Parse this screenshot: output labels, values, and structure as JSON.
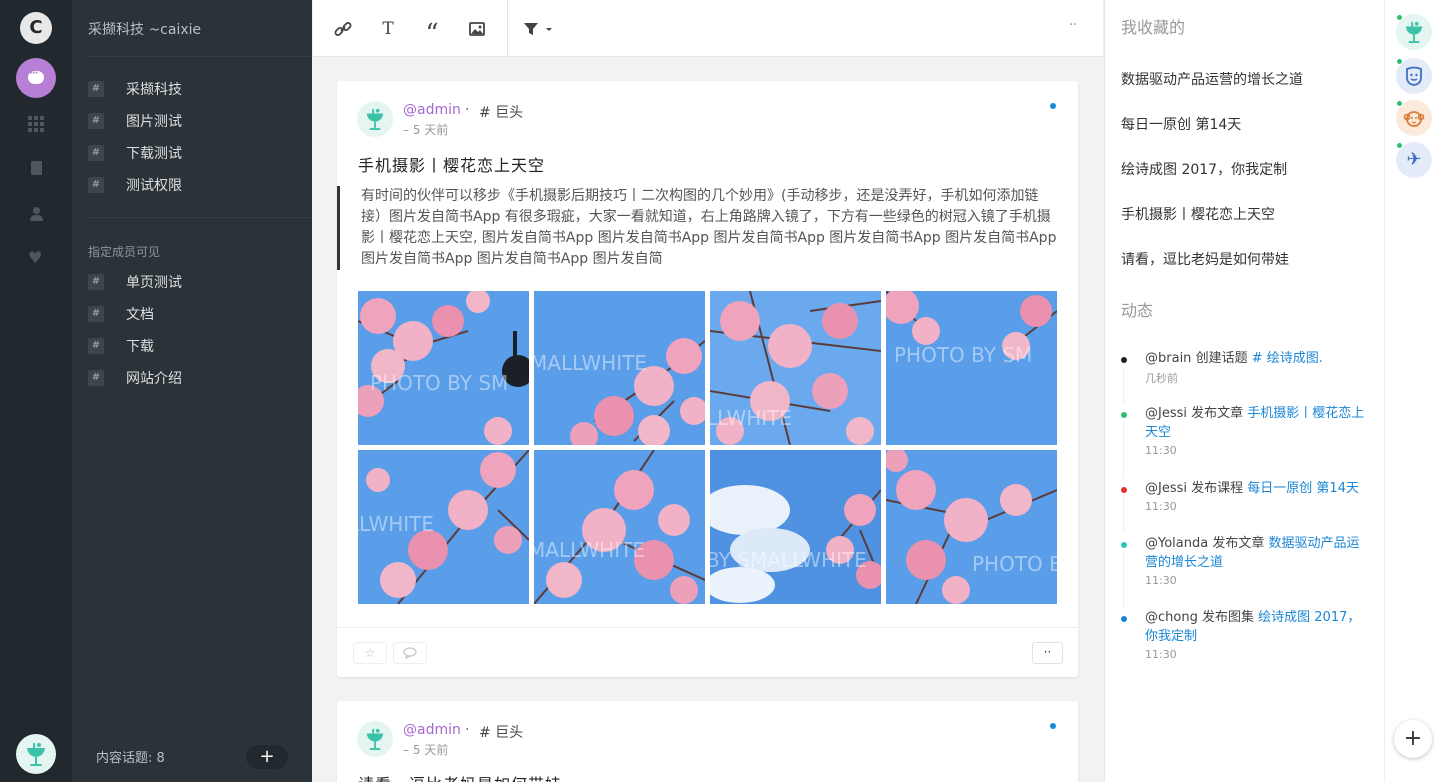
{
  "rail": {
    "logo_letter": "C",
    "icons": [
      "chat-icon",
      "apps-grid-icon",
      "document-icon",
      "user-icon",
      "heart-icon"
    ]
  },
  "sidebar": {
    "team_name": "采撷科技 ~caixie",
    "channels": [
      {
        "hash": "#",
        "label": "采撷科技"
      },
      {
        "hash": "#",
        "label": "图片测试"
      },
      {
        "hash": "#",
        "label": "下载测试"
      },
      {
        "hash": "#",
        "label": "测试权限"
      }
    ],
    "section_title": "指定成员可见",
    "private_channels": [
      {
        "hash": "#",
        "label": "单页测试"
      },
      {
        "hash": "#",
        "label": "文档"
      },
      {
        "hash": "#",
        "label": "下载"
      },
      {
        "hash": "#",
        "label": "网站介绍"
      }
    ],
    "topic_count": "内容话题: 8",
    "add_label": "+"
  },
  "toolbar": {
    "icons": [
      "link-icon",
      "text-icon",
      "quote-icon",
      "image-icon",
      "filter-icon"
    ],
    "more": "··"
  },
  "posts": [
    {
      "author": "@admin",
      "separator": "·",
      "topic": "# 巨头",
      "time": "– 5 天前",
      "title": "手机摄影丨樱花恋上天空",
      "excerpt": "有时间的伙伴可以移步《手机摄影后期技巧丨二次构图的几个妙用》(手动移步，还是没弄好，手机如何添加链接）图片发自简书App 有很多瑕疵，大家一看就知道，右上角路牌入镜了，下方有一些绿色的树冠入镜了手机摄影丨樱花恋上天空, 图片发自简书App   图片发自简书App   图片发自简书App   图片发自简书App   图片发自简书App   图片发自简书App   图片发自简书App   图片发自简",
      "photo_watermarks": [
        "PHOTO BY SM",
        "MALLWHITE",
        "PHOTO BY SM",
        "LLWHITE",
        "MALLWHITE",
        "BY SMALLWHITE",
        "PHOTO B"
      ],
      "footer_more": "··"
    },
    {
      "author": "@admin",
      "separator": "·",
      "topic": "# 巨头",
      "time": "– 5 天前",
      "title": "请看，逗比老妈是如何带娃"
    }
  ],
  "right_panel": {
    "favorites_title": "我收藏的",
    "favorites": [
      "数据驱动产品运营的增长之道",
      "每日一原创 第14天",
      "绘诗成图 2017，你我定制",
      "手机摄影丨樱花恋上天空",
      "请看，逗比老妈是如何带娃"
    ],
    "activity_title": "动态",
    "activity": [
      {
        "actor": "@brain",
        "action": "创建话题",
        "target": "# 绘诗成图.",
        "time": "几秒前",
        "dot_color": "#222222"
      },
      {
        "actor": "@Jessi",
        "action": "发布文章",
        "target": "手机摄影丨樱花恋上天空",
        "time": "11:30",
        "dot_color": "#2fbf71"
      },
      {
        "actor": "@Jessi",
        "action": "发布课程",
        "target": "每日一原创 第14天",
        "time": "11:30",
        "dot_color": "#e0312e"
      },
      {
        "actor": "@Yolanda",
        "action": "发布文章",
        "target": "数据驱动产品运营的增长之道",
        "time": "11:30",
        "dot_color": "#2ec4b6"
      },
      {
        "actor": "@chong",
        "action": "发布图集",
        "target": "绘诗成图 2017，你我定制",
        "time": "11:30",
        "dot_color": "#1a86d6"
      }
    ]
  },
  "apps": {
    "items": [
      "goblet-app-icon",
      "shield-face-app-icon",
      "monkey-app-icon",
      "airplane-app-icon"
    ],
    "add_label": "+"
  },
  "colors": {
    "accent_purple": "#b77fd5",
    "link_blue": "#1a86d6",
    "online_green": "#2fbf71",
    "sidebar_bg": "#2b3338",
    "rail_bg": "#22292e"
  }
}
